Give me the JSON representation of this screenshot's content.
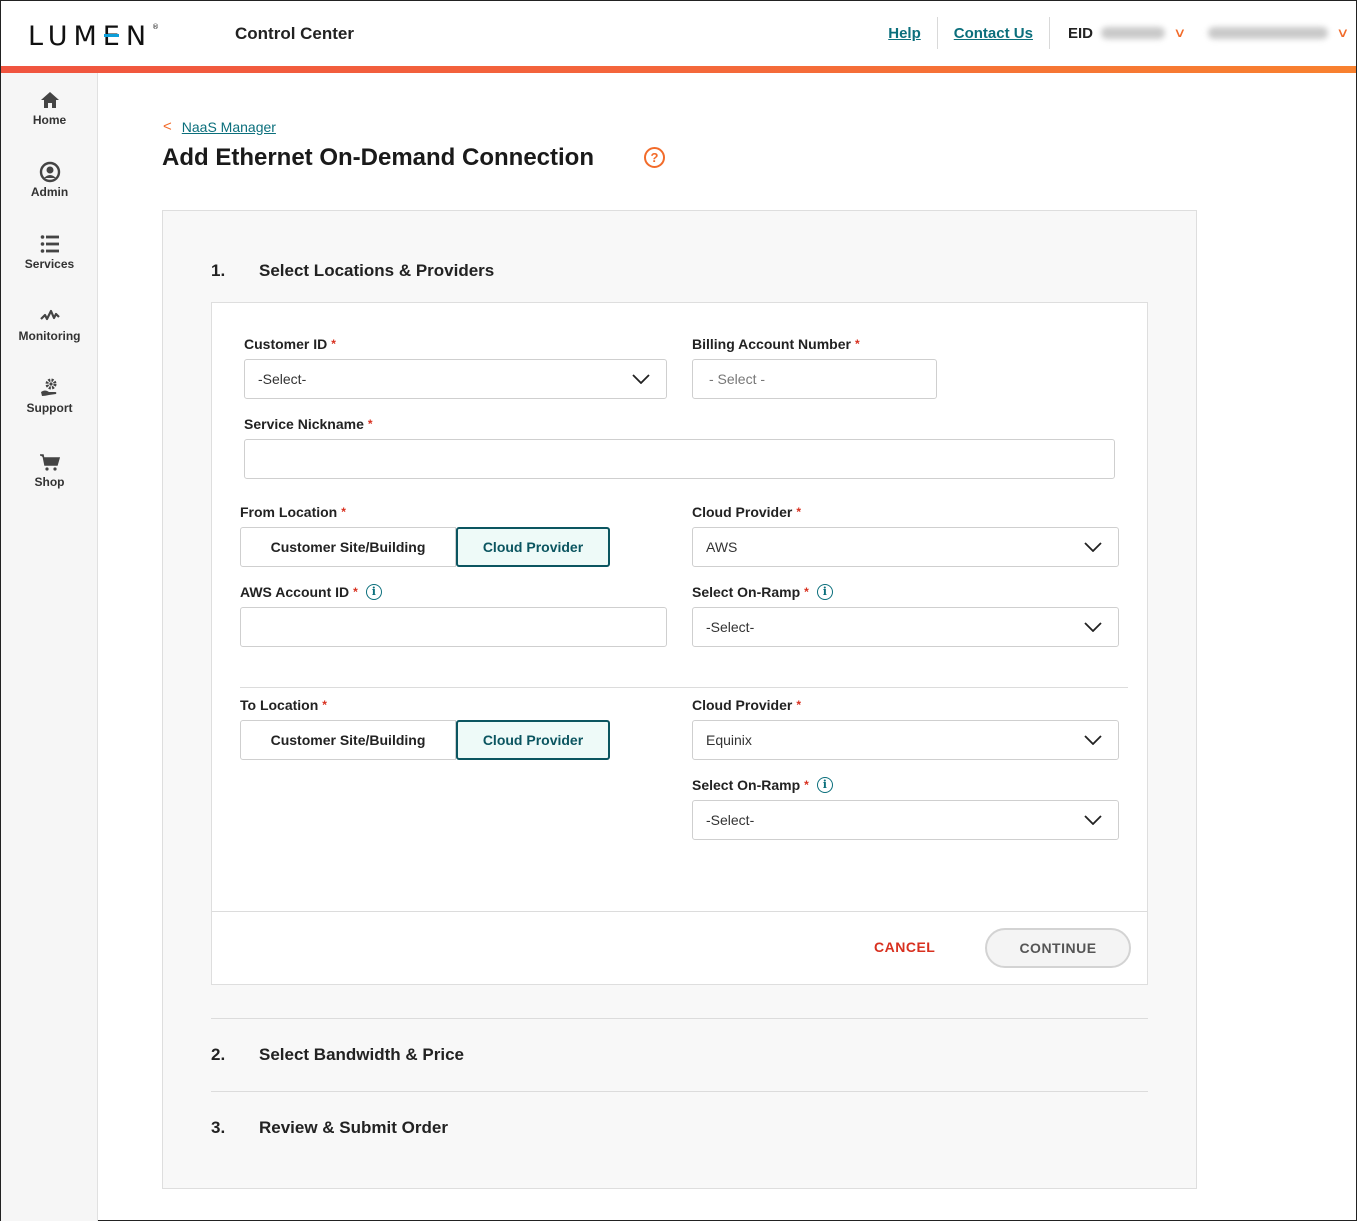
{
  "header": {
    "logo": "LUMEN",
    "app_title": "Control Center",
    "links": [
      "Help",
      "Contact Us"
    ],
    "eid_label": "EID",
    "brand_accent": "#f26b2a",
    "link_color": "#0b6f7c"
  },
  "sidebar": {
    "items": [
      {
        "label": "Home",
        "icon": "home-icon"
      },
      {
        "label": "Admin",
        "icon": "user-circle-icon"
      },
      {
        "label": "Services",
        "icon": "list-icon"
      },
      {
        "label": "Monitoring",
        "icon": "pulse-icon"
      },
      {
        "label": "Support",
        "icon": "support-gear-hand-icon"
      },
      {
        "label": "Shop",
        "icon": "cart-icon"
      }
    ]
  },
  "breadcrumb": {
    "label": "NaaS Manager"
  },
  "page": {
    "title": "Add Ethernet On-Demand Connection"
  },
  "steps": [
    {
      "number": "1.",
      "title": "Select Locations & Providers"
    },
    {
      "number": "2.",
      "title": "Select Bandwidth & Price"
    },
    {
      "number": "3.",
      "title": "Review & Submit Order"
    }
  ],
  "form": {
    "customer_id": {
      "label": "Customer ID",
      "value": "-Select-"
    },
    "billing_account": {
      "label": "Billing Account Number",
      "value": "- Select -"
    },
    "service_nickname": {
      "label": "Service Nickname",
      "value": ""
    },
    "from_location": {
      "label": "From Location",
      "options": [
        "Customer Site/Building",
        "Cloud Provider"
      ],
      "selected": "Cloud Provider"
    },
    "from_cloud_provider": {
      "label": "Cloud Provider",
      "value": "AWS"
    },
    "aws_account_id": {
      "label": "AWS Account ID",
      "value": ""
    },
    "from_on_ramp": {
      "label": "Select On-Ramp",
      "value": "-Select-"
    },
    "to_location": {
      "label": "To Location",
      "options": [
        "Customer Site/Building",
        "Cloud Provider"
      ],
      "selected": "Cloud Provider"
    },
    "to_cloud_provider": {
      "label": "Cloud Provider",
      "value": "Equinix"
    },
    "to_on_ramp": {
      "label": "Select On-Ramp",
      "value": "-Select-"
    },
    "required_mark": "*"
  },
  "actions": {
    "cancel": "CANCEL",
    "continue": "CONTINUE"
  }
}
